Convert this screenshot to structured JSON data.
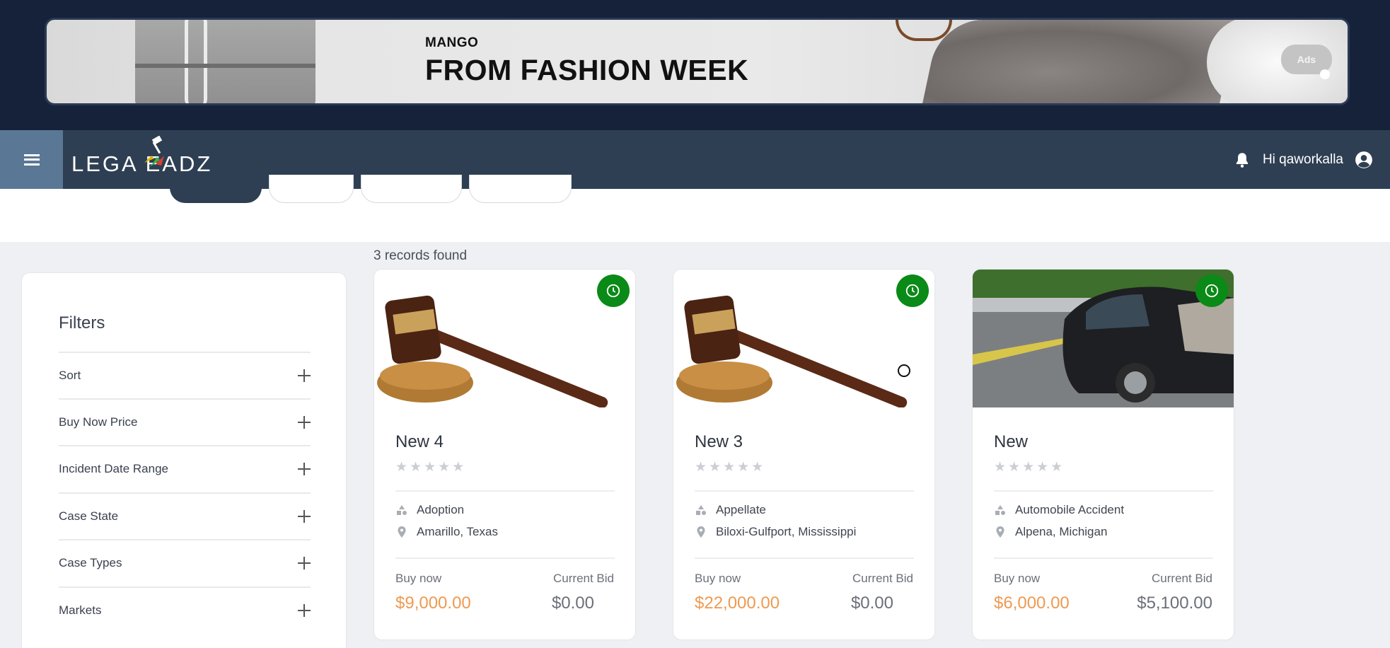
{
  "ad": {
    "brand": "MANGO",
    "headline": "FROM FASHION WEEK",
    "badge": "Ads"
  },
  "nav": {
    "logo": "LEGA  EADZ",
    "greeting": "Hi qaworkalla"
  },
  "results": {
    "count_text": "3 records found"
  },
  "filters": {
    "title": "Filters",
    "items": [
      {
        "label": "Sort"
      },
      {
        "label": "Buy Now Price"
      },
      {
        "label": "Incident Date Range"
      },
      {
        "label": "Case State"
      },
      {
        "label": "Case Types"
      },
      {
        "label": "Markets"
      }
    ]
  },
  "cards": [
    {
      "title": "New 4",
      "image": "gavel",
      "rating_stars": 5,
      "case_type": "Adoption",
      "location": "Amarillo, Texas",
      "buy_label": "Buy now",
      "buy_price": "$9,000.00",
      "bid_label": "Current Bid",
      "bid_price": "$0.00"
    },
    {
      "title": "New 3",
      "image": "gavel",
      "rating_stars": 5,
      "case_type": "Appellate",
      "location": "Biloxi-Gulfport, Mississippi",
      "buy_label": "Buy now",
      "buy_price": "$22,000.00",
      "bid_label": "Current Bid",
      "bid_price": "$0.00"
    },
    {
      "title": "New",
      "image": "car-accident",
      "rating_stars": 5,
      "case_type": "Automobile Accident",
      "location": "Alpena, Michigan",
      "buy_label": "Buy now",
      "buy_price": "$6,000.00",
      "bid_label": "Current Bid",
      "bid_price": "$5,100.00"
    }
  ],
  "colors": {
    "nav_bg": "#2e3f53",
    "banner_bg": "#15223a",
    "clock_badge": "#0a8a16",
    "buy_price": "#ee9a52"
  }
}
